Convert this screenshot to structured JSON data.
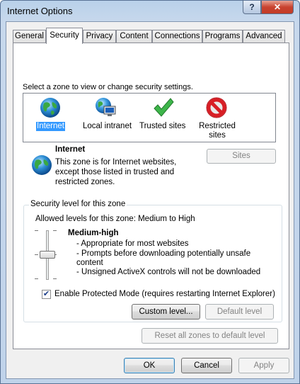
{
  "window": {
    "title": "Internet Options",
    "help_label": "?",
    "close_label": "✕"
  },
  "tabs": [
    {
      "label": "General"
    },
    {
      "label": "Security"
    },
    {
      "label": "Privacy"
    },
    {
      "label": "Content"
    },
    {
      "label": "Connections"
    },
    {
      "label": "Programs"
    },
    {
      "label": "Advanced"
    }
  ],
  "active_tab": "Security",
  "zones": {
    "prompt": "Select a zone to view or change security settings.",
    "items": [
      {
        "label": "Internet",
        "icon": "globe-icon",
        "selected": true
      },
      {
        "label": "Local intranet",
        "icon": "intranet-icon",
        "selected": false
      },
      {
        "label": "Trusted sites",
        "icon": "checkmark-icon",
        "selected": false
      },
      {
        "label_line1": "Restricted",
        "label_line2": "sites",
        "icon": "restricted-icon",
        "selected": false
      }
    ]
  },
  "zone_info": {
    "title": "Internet",
    "description": "This zone is for Internet websites, except those listed in trusted and restricted zones.",
    "sites_button": "Sites"
  },
  "security_level": {
    "group_label": "Security level for this zone",
    "allowed_levels": "Allowed levels for this zone: Medium to High",
    "level_name": "Medium-high",
    "details": [
      "- Appropriate for most websites",
      "- Prompts before downloading potentially unsafe",
      "content",
      "- Unsigned ActiveX controls will not be downloaded"
    ],
    "slider_level": "Medium-high"
  },
  "protected_mode": {
    "label": "Enable Protected Mode (requires restarting Internet Explorer)",
    "checked": true,
    "check_glyph": "✔"
  },
  "buttons": {
    "custom_level": "Custom level...",
    "default_level": "Default level",
    "reset_all": "Reset all zones to default level",
    "ok": "OK",
    "cancel": "Cancel",
    "apply": "Apply"
  },
  "colors": {
    "selection": "#3399ff",
    "close_button": "#c8422f",
    "title_gradient": "#b9d1ea"
  }
}
